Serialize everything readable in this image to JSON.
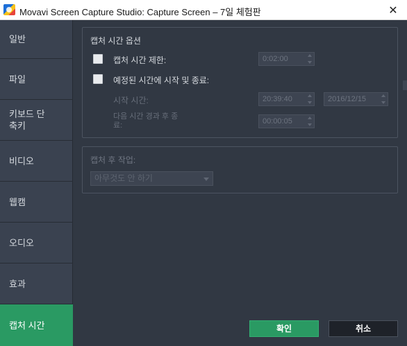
{
  "window": {
    "title": "Movavi Screen Capture Studio: Capture Screen – 7일 체험판",
    "close_glyph": "✕"
  },
  "sidebar": {
    "items": [
      {
        "label": "일반",
        "active": false
      },
      {
        "label": "파일",
        "active": false
      },
      {
        "label": "키보드 단축키",
        "active": false
      },
      {
        "label": "비디오",
        "active": false
      },
      {
        "label": "웹캠",
        "active": false
      },
      {
        "label": "오디오",
        "active": false
      },
      {
        "label": "효과",
        "active": false
      },
      {
        "label": "캡처 시간",
        "active": true
      }
    ]
  },
  "capture_time_options": {
    "title": "캡처 시간 옵션",
    "limit": {
      "label": "캡처 시간 제한:",
      "checked": false,
      "value": "0:02:00"
    },
    "schedule": {
      "label": "예정된 시간에 시작 및 종료:",
      "checked": false
    },
    "start_time": {
      "label": "시작 시간:",
      "time": "20:39:40",
      "date": "2016/12/15"
    },
    "end_after": {
      "label": "다음 시간 경과 후 종료:",
      "value": "00:00:05"
    }
  },
  "after_capture": {
    "title": "캡처 후 작업:",
    "selected": "아무것도 안 하기"
  },
  "buttons": {
    "ok": "확인",
    "cancel": "취소"
  },
  "colors": {
    "accent": "#2a9a63",
    "background": "#313843",
    "sidebar": "#3a4250"
  }
}
